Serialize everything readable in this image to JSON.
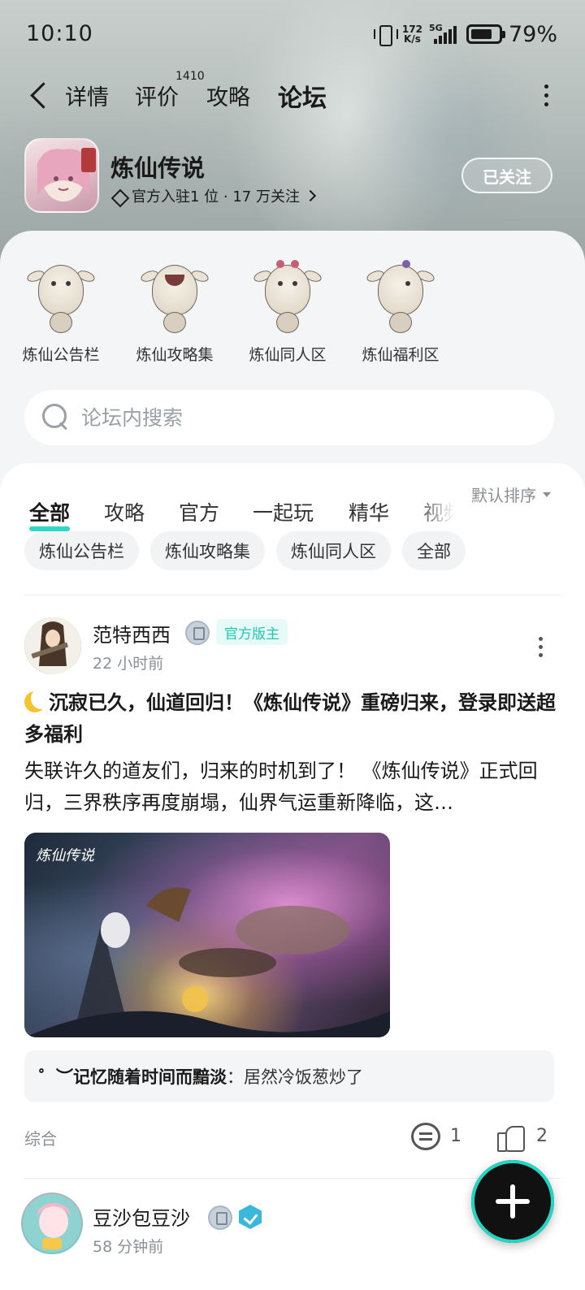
{
  "status_bar": {
    "time": "10:10",
    "net_speed_top": "172",
    "net_speed_bottom": "K/s",
    "network": "5G",
    "battery": "79%",
    "battery_level": 0.79
  },
  "nav": {
    "tabs": [
      {
        "label": "详情"
      },
      {
        "label": "评价"
      },
      {
        "label": "攻略"
      },
      {
        "label": "论坛"
      }
    ],
    "review_count": "1410",
    "active_tab": "论坛"
  },
  "game": {
    "name": "炼仙传说",
    "meta": "官方入驻1 位 · 17 万关注",
    "follow_label": "已关注"
  },
  "sections": [
    {
      "label": "炼仙公告栏"
    },
    {
      "label": "炼仙攻略集"
    },
    {
      "label": "炼仙同人区"
    },
    {
      "label": "炼仙福利区"
    }
  ],
  "search": {
    "placeholder": "论坛内搜索"
  },
  "feed_tabs": [
    {
      "label": "全部"
    },
    {
      "label": "攻略"
    },
    {
      "label": "官方"
    },
    {
      "label": "一起玩"
    },
    {
      "label": "精华"
    },
    {
      "label": "视频"
    }
  ],
  "sort_label": "默认排序",
  "chips": [
    {
      "label": "炼仙公告栏"
    },
    {
      "label": "炼仙攻略集"
    },
    {
      "label": "炼仙同人区"
    },
    {
      "label": "全部"
    }
  ],
  "posts": [
    {
      "author": "范特西西",
      "badge": "官方版主",
      "time": "22 小时前",
      "title": "沉寂已久，仙道回归！《炼仙传说》重磅归来，登录即送超多福利",
      "body": "失联许久的道友们，归来的时机到了！ 《炼仙传说》正式回归，三界秩序再度崩塌，仙界气运重新降临，这…",
      "image_logo": "炼仙传说",
      "comment_user": "゜︶记忆随着时间而黯淡",
      "comment_text": "居然冷饭葱炒了",
      "category": "综合",
      "comments": "1",
      "likes": "2"
    },
    {
      "author": "豆沙包豆沙",
      "time": "58 分钟前"
    }
  ]
}
